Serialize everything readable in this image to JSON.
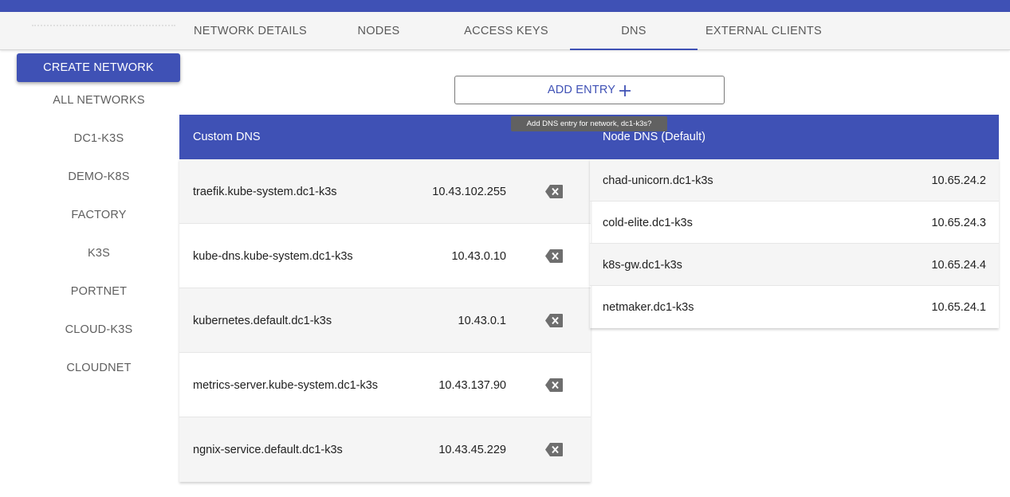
{
  "tabs": [
    {
      "label": "NETWORK DETAILS"
    },
    {
      "label": "NODES"
    },
    {
      "label": "ACCESS KEYS"
    },
    {
      "label": "DNS"
    },
    {
      "label": "EXTERNAL CLIENTS"
    }
  ],
  "active_tab": "DNS",
  "sidebar": {
    "create_label": "CREATE NETWORK",
    "items": [
      {
        "label": "ALL NETWORKS"
      },
      {
        "label": "DC1-K3S"
      },
      {
        "label": "DEMO-K8S"
      },
      {
        "label": "FACTORY"
      },
      {
        "label": "K3S"
      },
      {
        "label": "PORTNET"
      },
      {
        "label": "CLOUD-K3S"
      },
      {
        "label": "CLOUDNET"
      }
    ]
  },
  "add_entry": {
    "label": "ADD ENTRY",
    "icon": "plus-icon",
    "tooltip": "Add DNS entry for network, dc1-k3s?"
  },
  "custom_dns": {
    "title": "Custom DNS",
    "entries": [
      {
        "name": "traefik.kube-system.dc1-k3s",
        "ip": "10.43.102.255"
      },
      {
        "name": "kube-dns.kube-system.dc1-k3s",
        "ip": "10.43.0.10"
      },
      {
        "name": "kubernetes.default.dc1-k3s",
        "ip": "10.43.0.1"
      },
      {
        "name": "metrics-server.kube-system.dc1-k3s",
        "ip": "10.43.137.90"
      },
      {
        "name": "ngnix-service.default.dc1-k3s",
        "ip": "10.43.45.229"
      }
    ],
    "delete_icon": "backspace-delete-icon"
  },
  "node_dns": {
    "title": "Node DNS (Default)",
    "entries": [
      {
        "name": "chad-unicorn.dc1-k3s",
        "ip": "10.65.24.2"
      },
      {
        "name": "cold-elite.dc1-k3s",
        "ip": "10.65.24.3"
      },
      {
        "name": "k8s-gw.dc1-k3s",
        "ip": "10.65.24.4"
      },
      {
        "name": "netmaker.dc1-k3s",
        "ip": "10.65.24.1"
      }
    ]
  },
  "colors": {
    "primary": "#3f51b5",
    "row_alt": "#f5f5f5",
    "tooltip": "#616161"
  }
}
